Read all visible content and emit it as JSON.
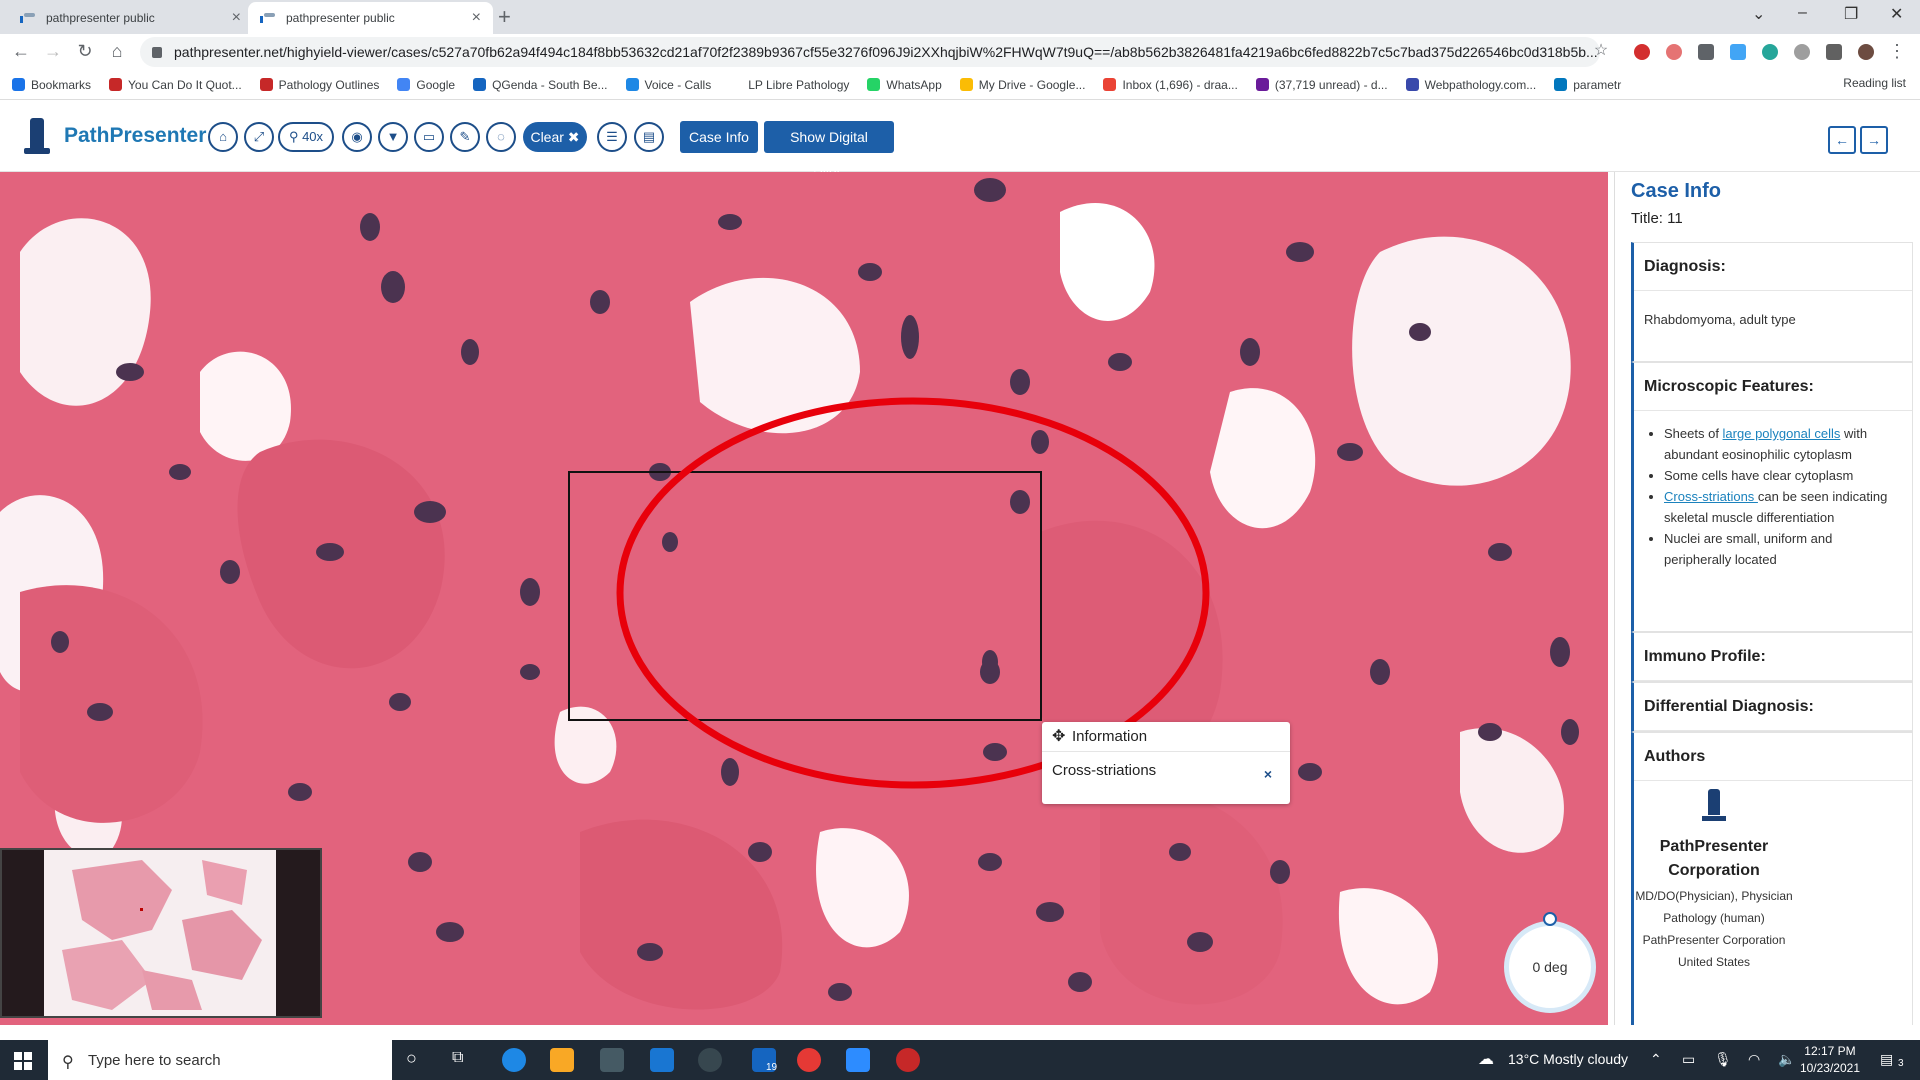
{
  "browser": {
    "tabs": [
      {
        "title": "pathpresenter public",
        "active": false
      },
      {
        "title": "pathpresenter public",
        "active": true
      }
    ],
    "url": "pathpresenter.net/highyield-viewer/cases/c527a70fb62a94f494c184f8bb53632cd21af70f2f2389b9367cf55e3276f096J9i2XXhqjbiW%2FHWqW7t9uQ==/ab8b562b3826481fa4219a6bc6fed8822b7c5c7bad375d226546bc0d318b5b...",
    "bookmarks": [
      {
        "label": "Bookmarks",
        "color": "#1a73e8"
      },
      {
        "label": "You Can Do It Quot...",
        "color": "#c62828"
      },
      {
        "label": "Pathology Outlines",
        "color": "#c62828"
      },
      {
        "label": "Google",
        "color": "#4285f4"
      },
      {
        "label": "QGenda - South Be...",
        "color": "#1565c0"
      },
      {
        "label": "Voice - Calls",
        "color": "#1e88e5"
      },
      {
        "label": "LP  Libre Pathology",
        "color": "#ffffff"
      },
      {
        "label": "WhatsApp",
        "color": "#25d366"
      },
      {
        "label": "My Drive - Google...",
        "color": "#fbbc05"
      },
      {
        "label": "Inbox (1,696) - draa...",
        "color": "#ea4335"
      },
      {
        "label": "(37,719 unread) - d...",
        "color": "#6a1b9a"
      },
      {
        "label": "Webpathology.com...",
        "color": "#3949ab"
      },
      {
        "label": "parametr",
        "color": "#0277bd"
      }
    ],
    "reading_list": "Reading list"
  },
  "app": {
    "name": "PathPresenter",
    "zoom_label": "40x",
    "clear_label": "Clear ✖",
    "case_info_button": "Case Info",
    "show_slide_button": "Show Digital Slide"
  },
  "viewer": {
    "popup_title": "Information",
    "popup_text": "Cross-striations",
    "popup_close": "×",
    "rotation": "0 deg",
    "annotation_color": "#e8000b"
  },
  "case_info": {
    "title": "Case Info",
    "subtitle": "Title: 11",
    "diagnosis_label": "Diagnosis:",
    "diagnosis_value": "Rhabdomyoma, adult type",
    "micro_label": "Microscopic Features:",
    "micro_items": [
      {
        "pre": "Sheets of ",
        "link": "large polygonal cells",
        "post": " with abundant eosinophilic cytoplasm"
      },
      {
        "pre": "Some cells have clear cytoplasm",
        "link": "",
        "post": ""
      },
      {
        "pre": "",
        "link": "Cross-striations ",
        "post": "can be seen indicating skeletal muscle differentiation"
      },
      {
        "pre": "Nuclei are small, uniform and peripherally located",
        "link": "",
        "post": ""
      }
    ],
    "immuno_label": "Immuno Profile:",
    "differential_label": "Differential Diagnosis:",
    "authors_label": "Authors",
    "author": {
      "name": "PathPresenter Corporation",
      "role": "MD/DO(Physician), Physician",
      "specialty": "Pathology (human)",
      "org": "PathPresenter Corporation",
      "country": "United States"
    }
  },
  "taskbar": {
    "search_placeholder": "Type here to search",
    "weather": "13°C  Mostly cloudy",
    "time": "12:17 PM",
    "date": "10/23/2021",
    "notification_count": "3",
    "badge": "19"
  },
  "colors": {
    "brand_blue": "#1d5fa8",
    "tissue_pink": "#e56a82",
    "nucleus_purple": "#4b3350"
  }
}
